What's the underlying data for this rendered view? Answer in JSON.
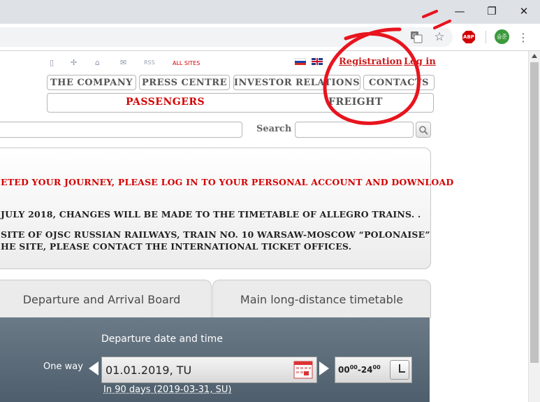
{
  "browser": {
    "window_controls": {
      "minimize": "—",
      "restore": "❐",
      "close": "✕"
    },
    "toolbar": {
      "adblock_badge": "ABP",
      "profile_initials": "승준"
    }
  },
  "header": {
    "top_icons": [
      "mobile-icon",
      "sitemap-icon",
      "home-icon",
      "mail-icon"
    ],
    "rss": "RSS",
    "all_sites": "ALL SITES",
    "registration": "Registration",
    "login": "Log in"
  },
  "nav": {
    "company": "THE COMPANY",
    "press": "PRESS CENTRE",
    "investor": "INVESTOR RELATIONS",
    "contacts": "CONTACTS",
    "passengers": "PASSENGERS",
    "freight": "FREIGHT"
  },
  "search": {
    "label": "Search",
    "value": ""
  },
  "notices": {
    "line1": "ETED YOUR JOURNEY, PLEASE LOG IN TO YOUR PERSONAL ACCOUNT AND DOWNLOAD",
    "line2": "JULY 2018, CHANGES WILL BE MADE TO THE TIMETABLE OF ALLEGRO TRAINS. .",
    "line3": "SITE OF OJSC RUSSIAN RAILWAYS, TRAIN NO. 10 WARSAW-MOSCOW “POLONAISE”",
    "line4": "HE SITE, PLEASE CONTACT THE INTERNATIONAL TICKET OFFICES."
  },
  "tabs": {
    "board": "Departure and Arrival Board",
    "timetable": "Main long-distance timetable"
  },
  "booking": {
    "heading": "Departure date and time",
    "one_way": "One way",
    "date": "01.01.2019, TU",
    "time_from": "00",
    "time_from_sup": "00",
    "time_to": "24",
    "time_to_sup": "00",
    "days_link": "In 90 days (2019-03-31, SU)"
  },
  "colors": {
    "accent_red": "#d40000",
    "link_red": "#cc1f1f",
    "nav_text": "#555555",
    "booking_bg": "#5a6a78",
    "annotation_red": "#e8141e"
  }
}
